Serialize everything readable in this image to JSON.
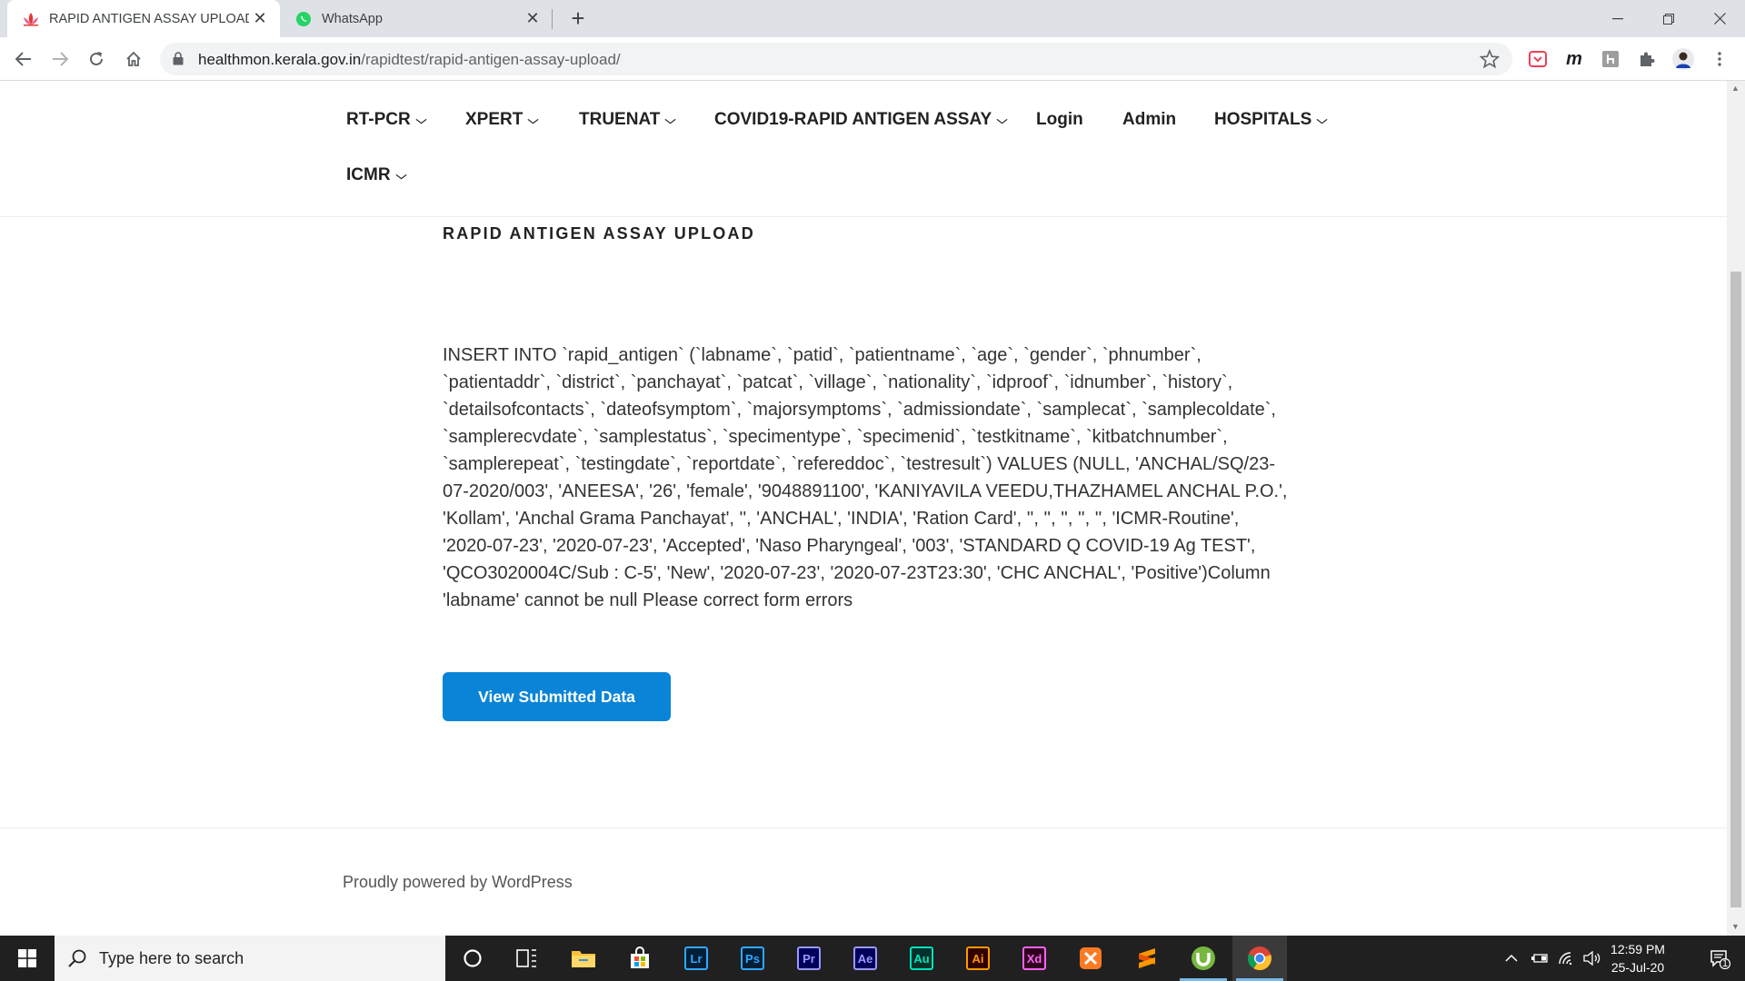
{
  "browser": {
    "tabs": [
      {
        "title": "RAPID ANTIGEN ASSAY UPLOAD",
        "active": true,
        "icon": "lotus-favicon-icon"
      },
      {
        "title": "WhatsApp",
        "active": false,
        "icon": "whatsapp-icon"
      }
    ],
    "new_tab_symbol": "+",
    "url_host": "healthmon.kerala.gov.in",
    "url_path": "/rapidtest/rapid-antigen-assay-upload/",
    "extension_m": "m",
    "window_controls": {
      "minimize": "—",
      "restore": "❐",
      "close": "✕"
    }
  },
  "nav": {
    "items": [
      {
        "label": "RT-PCR",
        "dropdown": true
      },
      {
        "label": "XPERT",
        "dropdown": true
      },
      {
        "label": "TRUENAT",
        "dropdown": true
      },
      {
        "label": "COVID19-RAPID ANTIGEN ASSAY",
        "dropdown": true
      },
      {
        "label": "Login",
        "dropdown": false
      },
      {
        "label": "Admin",
        "dropdown": false
      },
      {
        "label": "HOSPITALS",
        "dropdown": true
      },
      {
        "label": "ICMR",
        "dropdown": true
      }
    ],
    "chevron": "⌄"
  },
  "page": {
    "title": "RAPID ANTIGEN ASSAY UPLOAD",
    "message": "INSERT INTO `rapid_antigen` (`labname`, `patid`, `patientname`, `age`, `gender`, `phnumber`, `patientaddr`, `district`, `panchayat`, `patcat`, `village`, `nationality`, `idproof`, `idnumber`, `history`, `detailsofcontacts`, `dateofsymptom`, `majorsymptoms`, `admissiondate`, `samplecat`, `samplecoldate`, `samplerecvdate`, `samplestatus`, `specimentype`, `specimenid`, `testkitname`, `kitbatchnumber`, `samplerepeat`, `testingdate`, `reportdate`, `refereddoc`, `testresult`) VALUES (NULL, 'ANCHAL/SQ/23-07-2020/003', 'ANEESA', '26', 'female', '9048891100', 'KANIYAVILA VEEDU,THAZHAMEL ANCHAL P.O.', 'Kollam', 'Anchal Grama Panchayat', '', 'ANCHAL', 'INDIA', 'Ration Card', '', '', '', '', '', 'ICMR-Routine', '2020-07-23', '2020-07-23', 'Accepted', 'Naso Pharyngeal', '003', 'STANDARD Q COVID-19 Ag TEST', 'QCO3020004C/Sub : C-5', 'New', '2020-07-23', '2020-07-23T23:30', 'CHC ANCHAL', 'Positive')Column 'labname' cannot be null Please correct form errors",
    "button_label": "View Submitted Data",
    "footer": "Proudly powered by WordPress"
  },
  "taskbar": {
    "search_placeholder": "Type here to search",
    "apps": [
      {
        "name": "lightroom",
        "label": "Lr",
        "color": "#31a8ff",
        "bg": "#001e36"
      },
      {
        "name": "photoshop",
        "label": "Ps",
        "color": "#31a8ff",
        "bg": "#001e36"
      },
      {
        "name": "premiere",
        "label": "Pr",
        "color": "#9999ff",
        "bg": "#00005b"
      },
      {
        "name": "after-effects",
        "label": "Ae",
        "color": "#9999ff",
        "bg": "#00005b"
      },
      {
        "name": "audition",
        "label": "Au",
        "color": "#00e4bb",
        "bg": "#00312b"
      },
      {
        "name": "illustrator",
        "label": "Ai",
        "color": "#ff9a00",
        "bg": "#330000"
      },
      {
        "name": "xd",
        "label": "Xd",
        "color": "#ff61f6",
        "bg": "#2e001e"
      }
    ],
    "time": "12:59 PM",
    "date": "25-Jul-20",
    "notification_count": "1"
  },
  "colors": {
    "button_blue": "#0a84d6",
    "tab_bar": "#dee1e6",
    "taskbar": "#202020"
  }
}
